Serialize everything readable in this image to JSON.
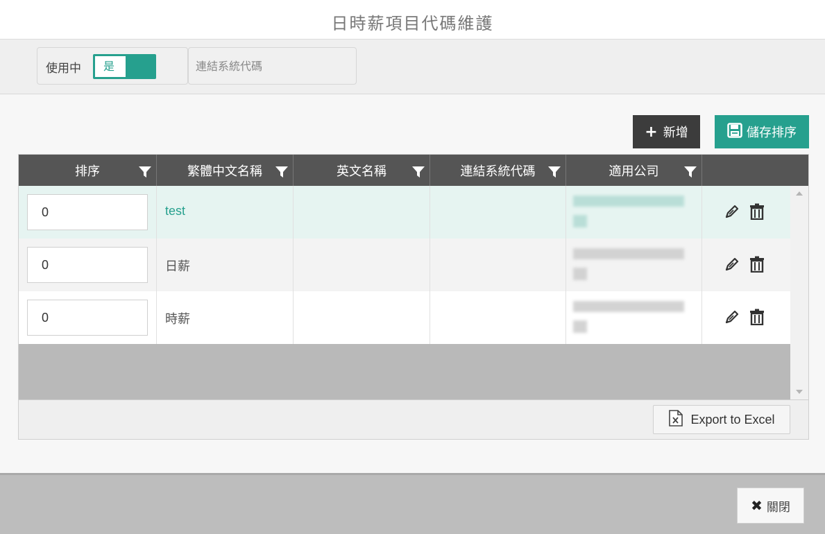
{
  "header": {
    "title": "日時薪項目代碼維護"
  },
  "filters": {
    "active_label": "使用中",
    "active_value": "是",
    "system_code_placeholder": "連結系統代碼"
  },
  "toolbar": {
    "add_label": "新增",
    "save_order_label": "儲存排序"
  },
  "grid": {
    "columns": [
      "排序",
      "繁體中文名稱",
      "英文名稱",
      "連結系統代碼",
      "適用公司",
      ""
    ],
    "rows": [
      {
        "order": "0",
        "name_zh": "test",
        "name_en": "",
        "system_code": "",
        "company": "(blurred)"
      },
      {
        "order": "0",
        "name_zh": "日薪",
        "name_en": "",
        "system_code": "",
        "company": "(blurred)"
      },
      {
        "order": "0",
        "name_zh": "時薪",
        "name_en": "",
        "system_code": "",
        "company": "(blurred)"
      }
    ],
    "export_label": "Export to Excel"
  },
  "footer": {
    "close_label": "關閉"
  },
  "colors": {
    "accent": "#26a08e",
    "header_bg": "#555555",
    "dark_button": "#3c3c3c"
  }
}
